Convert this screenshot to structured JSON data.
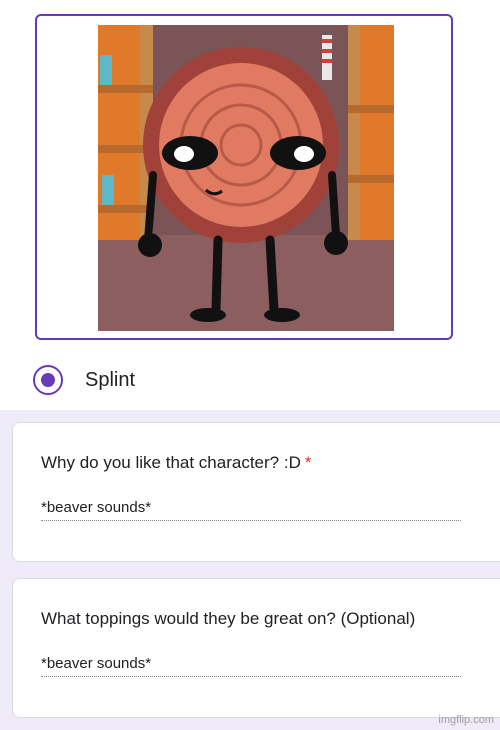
{
  "option": {
    "label": "Splint",
    "selected": true,
    "image_alt": "Splint character image"
  },
  "questions": [
    {
      "text": "Why do you like that character? :D",
      "required_mark": "*",
      "answer": "*beaver sounds*"
    },
    {
      "text": "What toppings would they be great on? (Optional)",
      "answer": "*beaver sounds*"
    }
  ],
  "watermark": "imgflip.com",
  "colors": {
    "accent": "#673ab7",
    "required": "#d93025",
    "background": "#f0ebf8"
  }
}
